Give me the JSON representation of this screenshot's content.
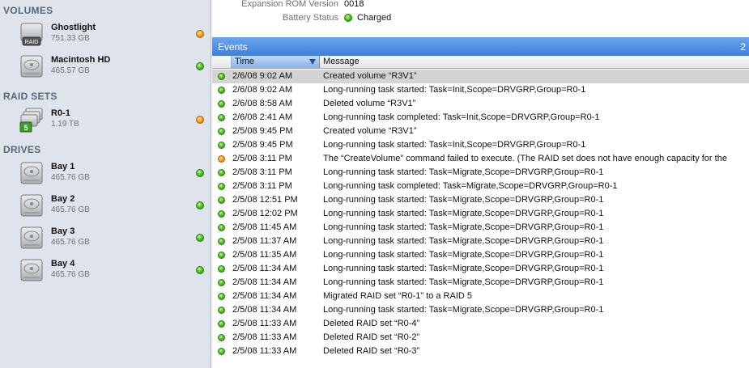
{
  "sidebar": {
    "sections": {
      "volumes": "VOLUMES",
      "raid_sets": "RAID SETS",
      "drives": "DRIVES"
    },
    "volumes": [
      {
        "name": "Ghostlight",
        "size": "751.33 GB",
        "status": "orange",
        "badge": "RAID"
      },
      {
        "name": "Macintosh HD",
        "size": "465.57 GB",
        "status": "green"
      }
    ],
    "raid_sets": [
      {
        "name": "R0-1",
        "size": "1.19 TB",
        "status": "orange",
        "badge": "5"
      }
    ],
    "drives": [
      {
        "name": "Bay 1",
        "size": "465.76 GB",
        "status": "green"
      },
      {
        "name": "Bay 2",
        "size": "465.76 GB",
        "status": "green"
      },
      {
        "name": "Bay 3",
        "size": "465.76 GB",
        "status": "green"
      },
      {
        "name": "Bay 4",
        "size": "465.76 GB",
        "status": "green"
      }
    ]
  },
  "info": {
    "expansion_rom_label": "Expansion ROM Version",
    "expansion_rom_value": "0018",
    "battery_label": "Battery Status",
    "battery_value": "Charged"
  },
  "events": {
    "title": "Events",
    "count": "2",
    "columns": {
      "time": "Time",
      "message": "Message"
    },
    "rows": [
      {
        "status": "green",
        "time": "2/6/08 9:02 AM",
        "message": "Created volume “R3V1”",
        "selected": true
      },
      {
        "status": "green",
        "time": "2/6/08 9:02 AM",
        "message": "Long-running task started: Task=Init,Scope=DRVGRP,Group=R0-1"
      },
      {
        "status": "green",
        "time": "2/6/08 8:58 AM",
        "message": "Deleted volume “R3V1”"
      },
      {
        "status": "green",
        "time": "2/6/08 2:41 AM",
        "message": "Long-running task completed: Task=Init,Scope=DRVGRP,Group=R0-1"
      },
      {
        "status": "green",
        "time": "2/5/08 9:45 PM",
        "message": "Created volume “R3V1”"
      },
      {
        "status": "green",
        "time": "2/5/08 9:45 PM",
        "message": "Long-running task started: Task=Init,Scope=DRVGRP,Group=R0-1"
      },
      {
        "status": "orange",
        "time": "2/5/08 3:11 PM",
        "message": "The “CreateVolume” command failed to execute. (The RAID set does not have enough capacity for the"
      },
      {
        "status": "green",
        "time": "2/5/08 3:11 PM",
        "message": "Long-running task started: Task=Migrate,Scope=DRVGRP,Group=R0-1"
      },
      {
        "status": "green",
        "time": "2/5/08 3:11 PM",
        "message": "Long-running task completed: Task=Migrate,Scope=DRVGRP,Group=R0-1"
      },
      {
        "status": "green",
        "time": "2/5/08 12:51 PM",
        "message": "Long-running task started: Task=Migrate,Scope=DRVGRP,Group=R0-1"
      },
      {
        "status": "green",
        "time": "2/5/08 12:02 PM",
        "message": "Long-running task started: Task=Migrate,Scope=DRVGRP,Group=R0-1"
      },
      {
        "status": "green",
        "time": "2/5/08 11:45 AM",
        "message": "Long-running task started: Task=Migrate,Scope=DRVGRP,Group=R0-1"
      },
      {
        "status": "green",
        "time": "2/5/08 11:37 AM",
        "message": "Long-running task started: Task=Migrate,Scope=DRVGRP,Group=R0-1"
      },
      {
        "status": "green",
        "time": "2/5/08 11:35 AM",
        "message": "Long-running task started: Task=Migrate,Scope=DRVGRP,Group=R0-1"
      },
      {
        "status": "green",
        "time": "2/5/08 11:34 AM",
        "message": "Long-running task started: Task=Migrate,Scope=DRVGRP,Group=R0-1"
      },
      {
        "status": "green",
        "time": "2/5/08 11:34 AM",
        "message": "Long-running task started: Task=Migrate,Scope=DRVGRP,Group=R0-1"
      },
      {
        "status": "green",
        "time": "2/5/08 11:34 AM",
        "message": "Migrated RAID set “R0-1” to a RAID 5"
      },
      {
        "status": "green",
        "time": "2/5/08 11:34 AM",
        "message": "Long-running task started: Task=Migrate,Scope=DRVGRP,Group=R0-1"
      },
      {
        "status": "green",
        "time": "2/5/08 11:33 AM",
        "message": "Deleted RAID set “R0-4”"
      },
      {
        "status": "green",
        "time": "2/5/08 11:33 AM",
        "message": "Deleted RAID set “R0-2”"
      },
      {
        "status": "green",
        "time": "2/5/08 11:33 AM",
        "message": "Deleted RAID set “R0-3”"
      }
    ]
  },
  "colors": {
    "status_green": "#53c323",
    "status_orange": "#f5a623",
    "selection_blue": "#3f7fd9"
  },
  "icons": {
    "drive": "hard-drive-icon",
    "raid_volume": "raid-volume-icon",
    "raid_set": "raid-set-icon",
    "status": "status-light-icon"
  }
}
